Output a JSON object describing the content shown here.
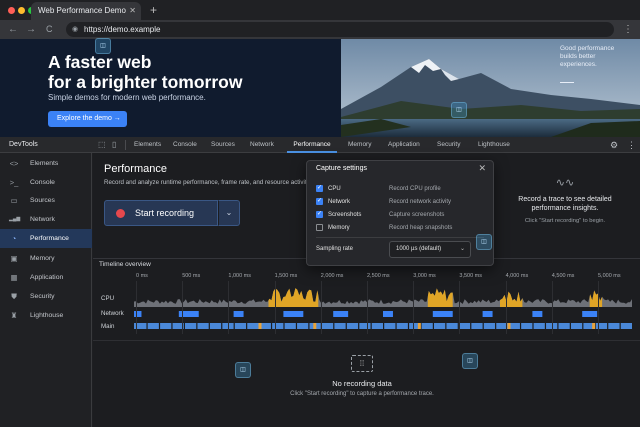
{
  "browser": {
    "tab_title": "Web Performance Demo",
    "tab_close": "✕",
    "new_tab": "+",
    "url": "https://demo.example",
    "back": "←",
    "forward": "→",
    "reload": "C",
    "menu": "⋮"
  },
  "hero": {
    "headline_1": "A faster web",
    "headline_2": "for a brighter tomorrow",
    "subtitle": "Simple demos for modern web performance.",
    "cta": "Explore the demo →",
    "note": "Good performance builds better experiences."
  },
  "devtools": {
    "title": "DevTools",
    "tabs": [
      "Elements",
      "Console",
      "Sources",
      "Network",
      "Performance",
      "Memory",
      "Application",
      "Security",
      "Lighthouse"
    ],
    "active_tab": "Performance",
    "sidebar": [
      {
        "label": "Elements",
        "icon": "code-icon",
        "glyph": "<>"
      },
      {
        "label": "Console",
        "icon": "terminal-icon",
        "glyph": ">_"
      },
      {
        "label": "Sources",
        "icon": "file-icon",
        "glyph": "▭"
      },
      {
        "label": "Network",
        "icon": "signal-bars-icon",
        "glyph": "▂▄▆"
      },
      {
        "label": "Performance",
        "icon": "gauge-icon",
        "glyph": "◔"
      },
      {
        "label": "Memory",
        "icon": "chip-icon",
        "glyph": "▣"
      },
      {
        "label": "Application",
        "icon": "grid-icon",
        "glyph": "▦"
      },
      {
        "label": "Security",
        "icon": "shield-icon",
        "glyph": "⛊"
      },
      {
        "label": "Lighthouse",
        "icon": "lighthouse-icon",
        "glyph": "♜"
      }
    ],
    "active_sidebar": "Performance"
  },
  "performance": {
    "title": "Performance",
    "description": "Record and analyze runtime performance, frame rate, and resource activity.",
    "record_label": "Start recording",
    "hint_title": "Record a trace to see detailed performance insights.",
    "hint_sub": "Click \"Start recording\" to begin."
  },
  "capture": {
    "title": "Capture settings",
    "close": "✕",
    "options": [
      {
        "name": "CPU",
        "desc": "Record CPU profile",
        "checked": true
      },
      {
        "name": "Network",
        "desc": "Record network activity",
        "checked": true
      },
      {
        "name": "Screenshots",
        "desc": "Capture screenshots",
        "checked": true
      },
      {
        "name": "Memory",
        "desc": "Record heap snapshots",
        "checked": false
      }
    ],
    "sampling_label": "Sampling rate",
    "sampling_value": "1000 µs (default)"
  },
  "timeline": {
    "title": "Timeline overview",
    "ticks": [
      "0 ms",
      "500 ms",
      "1,000 ms",
      "1,500 ms",
      "2,000 ms",
      "2,500 ms",
      "3,000 ms",
      "3,500 ms",
      "4,000 ms",
      "4,500 ms",
      "5,000 ms"
    ],
    "rows": [
      "CPU",
      "Network",
      "Main"
    ],
    "empty_title": "No recording data",
    "empty_sub": "Click \"Start recording\" to capture a performance trace."
  },
  "colors": {
    "accent": "#3b82f6",
    "record": "#e5484d",
    "cpu_base": "#6e7178",
    "cpu_highlight": "#e0a526",
    "network": "#3b82f6",
    "main_task": "#4a88d8",
    "main_highlight": "#e8a33a"
  }
}
